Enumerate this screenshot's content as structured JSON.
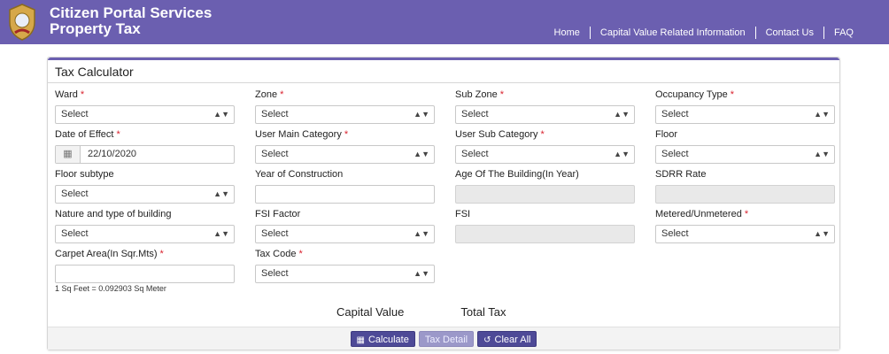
{
  "header": {
    "title_line1": "Citizen Portal Services",
    "title_line2": "Property Tax",
    "nav": {
      "home": "Home",
      "capital": "Capital Value Related Information",
      "contact": "Contact Us",
      "faq": "FAQ"
    }
  },
  "panel": {
    "title": "Tax Calculator",
    "fields": {
      "ward": {
        "label": "Ward",
        "value": "Select"
      },
      "zone": {
        "label": "Zone",
        "value": "Select"
      },
      "subzone": {
        "label": "Sub Zone",
        "value": "Select"
      },
      "occupancy": {
        "label": "Occupancy Type",
        "value": "Select"
      },
      "date_effect": {
        "label": "Date of Effect",
        "value": "22/10/2020"
      },
      "user_main": {
        "label": "User Main Category",
        "value": "Select"
      },
      "user_sub": {
        "label": "User Sub Category",
        "value": "Select"
      },
      "floor": {
        "label": "Floor",
        "value": "Select"
      },
      "floor_subtype": {
        "label": "Floor subtype",
        "value": "Select"
      },
      "year_construction": {
        "label": "Year of Construction",
        "value": ""
      },
      "age_building": {
        "label": "Age Of The Building(In Year)",
        "value": ""
      },
      "sdrr": {
        "label": "SDRR Rate",
        "value": ""
      },
      "nature": {
        "label": "Nature and type of building",
        "value": "Select"
      },
      "fsi_factor": {
        "label": "FSI Factor",
        "value": "Select"
      },
      "fsi": {
        "label": "FSI",
        "value": ""
      },
      "metered": {
        "label": "Metered/Unmetered",
        "value": "Select"
      },
      "carpet": {
        "label": "Carpet Area(In Sqr.Mts)",
        "value": ""
      },
      "tax_code": {
        "label": "Tax Code",
        "value": "Select"
      }
    },
    "hint": "1 Sq Feet = 0.092903 Sq Meter",
    "capital_value_label": "Capital Value",
    "total_tax_label": "Total Tax",
    "buttons": {
      "calculate": "Calculate",
      "tax_detail": "Tax Detail",
      "clear_all": "Clear All"
    },
    "required_mark": "*"
  },
  "colors": {
    "brand": "#6b5fb0",
    "button": "#4e4a97",
    "required": "#d9232f"
  }
}
